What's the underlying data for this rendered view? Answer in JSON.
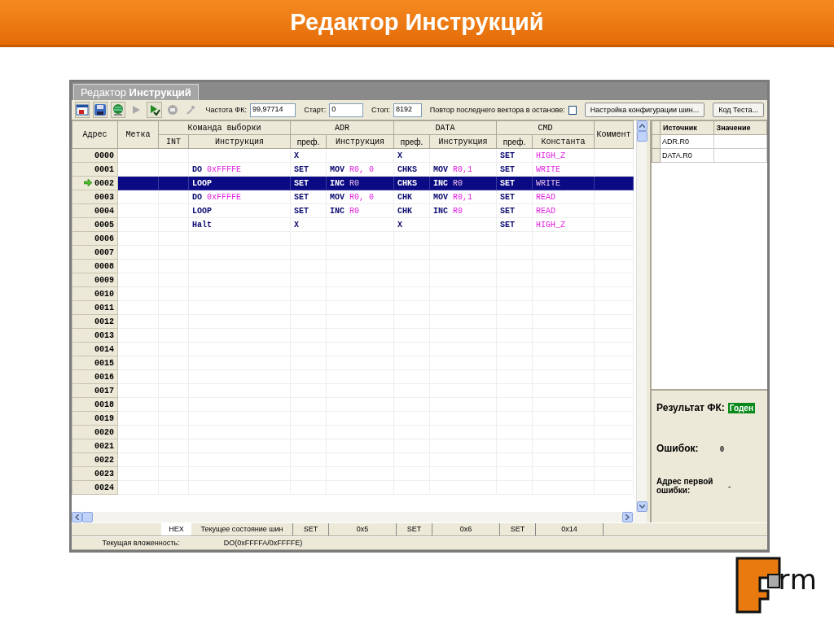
{
  "slide": {
    "title": "Редактор Инструкций"
  },
  "window": {
    "tab": {
      "label": "Редактор **Инструкций**",
      "selected": true
    }
  },
  "toolbar": {
    "tools": [
      {
        "kind": "report",
        "disabled": false
      },
      {
        "kind": "save",
        "disabled": false
      },
      {
        "kind": "globe",
        "disabled": false
      },
      {
        "kind": "play",
        "disabled": true
      },
      {
        "kind": "run",
        "disabled": false
      },
      {
        "kind": "stop",
        "disabled": true
      },
      {
        "kind": "step",
        "disabled": true
      }
    ],
    "fields": [
      {
        "label": "Частота ФК:",
        "value": "99,97714"
      },
      {
        "label": "Старт:",
        "value": "0"
      },
      {
        "label": "Стоп:",
        "value": "8192"
      }
    ],
    "repeat": {
      "label": "Повтор последнего вектора в останове:",
      "checked": false
    },
    "buttons": [
      "Настройка конфигурации шин...",
      "Код Теста..."
    ]
  },
  "table": {
    "groups": [
      {
        "label": "Адрес"
      },
      {
        "label": "Метка"
      },
      {
        "label": "Команда выборки",
        "columns": [
          "INT",
          "Инструкция"
        ]
      },
      {
        "label": "ADR",
        "columns": [
          "преф.",
          "Инструкция"
        ]
      },
      {
        "label": "DATA",
        "columns": [
          "преф.",
          "Инструкция"
        ]
      },
      {
        "label": "CMD",
        "columns": [
          "преф.",
          "Константа"
        ]
      },
      {
        "label": "Коммент"
      }
    ],
    "rows": [
      {
        "address": "0000",
        "current": false,
        "selected": false,
        "adr_pref": "X",
        "data_pref": "X",
        "cmd_pref": "SET",
        "constant": "HIGH_Z"
      },
      {
        "address": "0001",
        "current": false,
        "selected": false,
        "fetch": {
          "op": "DO",
          "arg": "0xFFFFE"
        },
        "adr_pref": "SET",
        "adr": {
          "op": "MOV",
          "arg": "R0, 0"
        },
        "data_pref": "CHKS",
        "data": {
          "op": "MOV",
          "arg": "R0,1"
        },
        "cmd_pref": "SET",
        "constant": "WRITE"
      },
      {
        "address": "0002",
        "current": true,
        "selected": true,
        "fetch": {
          "op": "LOOP"
        },
        "adr_pref": "SET",
        "adr": {
          "op": "INC",
          "arg": "R0"
        },
        "data_pref": "CHKS",
        "data": {
          "op": "INC",
          "arg": "R0"
        },
        "cmd_pref": "SET",
        "constant": "WRITE"
      },
      {
        "address": "0003",
        "current": false,
        "selected": false,
        "fetch": {
          "op": "DO",
          "arg": "0xFFFFE"
        },
        "adr_pref": "SET",
        "adr": {
          "op": "MOV",
          "arg": "R0, 0"
        },
        "data_pref": "CHK",
        "data": {
          "op": "MOV",
          "arg": "R0,1"
        },
        "cmd_pref": "SET",
        "constant": "READ"
      },
      {
        "address": "0004",
        "current": false,
        "selected": false,
        "fetch": {
          "op": "LOOP"
        },
        "adr_pref": "SET",
        "adr": {
          "op": "INC",
          "arg": "R0"
        },
        "data_pref": "CHK",
        "data": {
          "op": "INC",
          "arg": "R0"
        },
        "cmd_pref": "SET",
        "constant": "READ"
      },
      {
        "address": "0005",
        "current": false,
        "selected": false,
        "fetch": {
          "op": "Halt"
        },
        "adr_pref": "X",
        "data_pref": "X",
        "cmd_pref": "SET",
        "constant": "HIGH_Z"
      },
      {
        "address": "0006",
        "current": false,
        "selected": false
      },
      {
        "address": "0007",
        "current": false,
        "selected": false
      },
      {
        "address": "0008",
        "current": false,
        "selected": false
      },
      {
        "address": "0009",
        "current": false,
        "selected": false
      },
      {
        "address": "0010",
        "current": false,
        "selected": false
      },
      {
        "address": "0011",
        "current": false,
        "selected": false
      },
      {
        "address": "0012",
        "current": false,
        "selected": false
      },
      {
        "address": "0013",
        "current": false,
        "selected": false
      },
      {
        "address": "0014",
        "current": false,
        "selected": false
      },
      {
        "address": "0015",
        "current": false,
        "selected": false
      },
      {
        "address": "0016",
        "current": false,
        "selected": false
      },
      {
        "address": "0017",
        "current": false,
        "selected": false
      },
      {
        "address": "0018",
        "current": false,
        "selected": false
      },
      {
        "address": "0019",
        "current": false,
        "selected": false
      },
      {
        "address": "0020",
        "current": false,
        "selected": false
      },
      {
        "address": "0021",
        "current": false,
        "selected": false
      },
      {
        "address": "0022",
        "current": false,
        "selected": false
      },
      {
        "address": "0023",
        "current": false,
        "selected": false
      },
      {
        "address": "0024",
        "current": false,
        "selected": false
      }
    ]
  },
  "watch": {
    "columns": [
      "Источник",
      "Значение"
    ],
    "rows": [
      {
        "source": "ADR.R0"
      },
      {
        "source": "DATA.R0"
      }
    ]
  },
  "result": {
    "label": "Результат ФК:",
    "value": "Годен"
  },
  "errors": {
    "label": "Ошибок:",
    "value": "0"
  },
  "first_error": {
    "label": "Адрес первой ошибки:",
    "value": "-"
  },
  "bus_state": {
    "format": "HEX",
    "label": "Текущее состояние шин",
    "values": [
      "SET",
      "0x5",
      "SET",
      "0x6",
      "SET",
      "0x14"
    ]
  },
  "nesting": {
    "label": "Текущая вложенность:",
    "value": "DO(0xFFFFA/0xFFFFE)"
  },
  "logo": {
    "text": "rm"
  }
}
